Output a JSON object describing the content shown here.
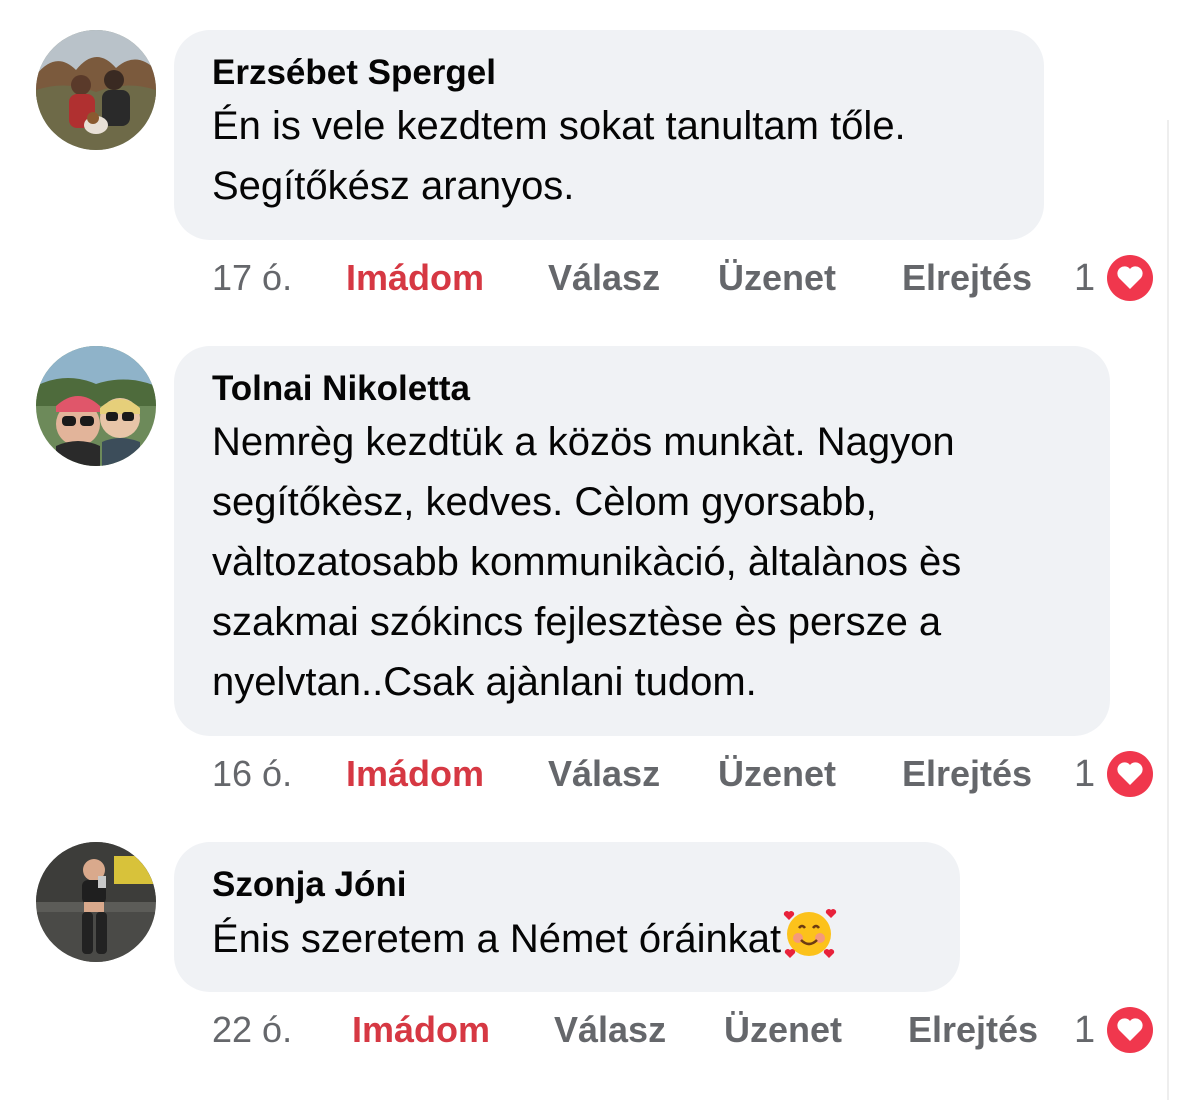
{
  "comments": [
    {
      "author": "Erzsébet Spergel",
      "lines": [
        "Én is vele kezdtem sokat tanultam tőle.",
        "Segítőkész aranyos."
      ],
      "time": "17 ó.",
      "reaction_label": "Imádom",
      "reply_label": "Válasz",
      "message_label": "Üzenet",
      "hide_label": "Elrejtés",
      "reaction_count": "1",
      "avatar_icon": "profile-photo"
    },
    {
      "author": "Tolnai Nikoletta",
      "lines": [
        "Nemrèg kezdtük a közös munkàt. Nagyon",
        "segítőkèsz, kedves. Cèlom gyorsabb,",
        "vàltozatosabb kommunikàció, àltalànos ès",
        "szakmai szókincs fejlesztèse ès persze a",
        "nyelvtan..Csak ajànlani tudom."
      ],
      "time": "16 ó.",
      "reaction_label": "Imádom",
      "reply_label": "Válasz",
      "message_label": "Üzenet",
      "hide_label": "Elrejtés",
      "reaction_count": "1",
      "avatar_icon": "profile-photo"
    },
    {
      "author": "Szonja Jóni",
      "lines": [
        "Énis szeretem a Német óráinkat"
      ],
      "emoji": "smiling-face-with-hearts",
      "time": "22 ó.",
      "reaction_label": "Imádom",
      "reply_label": "Válasz",
      "message_label": "Üzenet",
      "hide_label": "Elrejtés",
      "reaction_count": "1",
      "avatar_icon": "profile-photo"
    }
  ],
  "colors": {
    "bubble": "#f0f2f5",
    "love": "#d63843",
    "meta": "#65676b",
    "heart": "#f0374d"
  },
  "icons": {
    "reaction": "heart-icon"
  }
}
